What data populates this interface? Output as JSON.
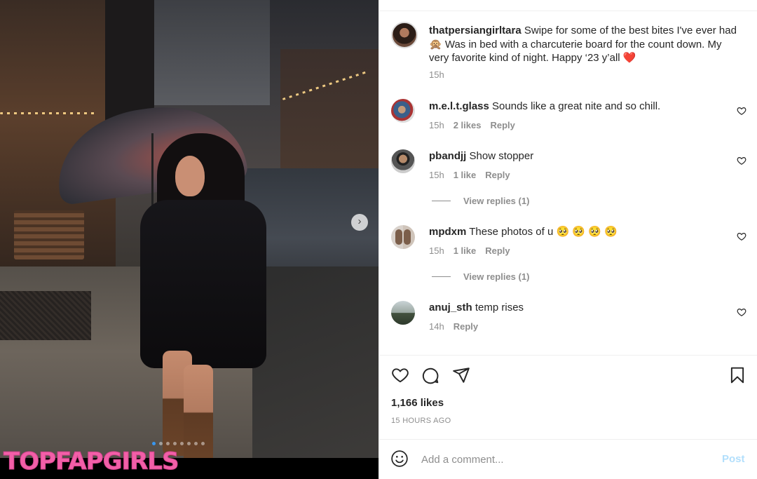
{
  "photo": {
    "watermark": "TOPFAPGIRLS",
    "carousel_count": 8,
    "carousel_active_index": 0,
    "next_icon": "chevron-right-icon"
  },
  "caption": {
    "username": "thatpersiangirltara",
    "text": "Swipe for some of the best bites I've ever had 🙊 Was in bed with a charcuterie board for the count down. My very favorite kind of night. Happy ‘23 y’all ❤️",
    "time": "15h"
  },
  "comments": [
    {
      "username": "m.e.l.t.glass",
      "text": "Sounds like a great nite and so chill.",
      "time": "15h",
      "likes": "2 likes",
      "reply": "Reply"
    },
    {
      "username": "pbandjj",
      "text": "Show stopper",
      "time": "15h",
      "likes": "1 like",
      "reply": "Reply",
      "view_replies": "View replies (1)"
    },
    {
      "username": "mpdxm",
      "text": "These photos of u 🥺 🥺 🥺 🥺",
      "time": "15h",
      "likes": "1 like",
      "reply": "Reply",
      "view_replies": "View replies (1)"
    },
    {
      "username": "anuj_sth",
      "text": "temp rises",
      "time": "14h",
      "reply": "Reply"
    }
  ],
  "actions": {
    "like_icon": "heart-icon",
    "comment_icon": "comment-icon",
    "share_icon": "send-icon",
    "save_icon": "bookmark-icon"
  },
  "stats": {
    "likes": "1,166 likes",
    "time_ago": "15 HOURS AGO"
  },
  "add_comment": {
    "placeholder": "Add a comment...",
    "post_label": "Post",
    "emoji_icon": "emoji-icon"
  },
  "colors": {
    "accent": "#0095f6",
    "post_disabled": "#b2dffc",
    "watermark": "#f25fa8",
    "muted": "#8e8e8e"
  }
}
